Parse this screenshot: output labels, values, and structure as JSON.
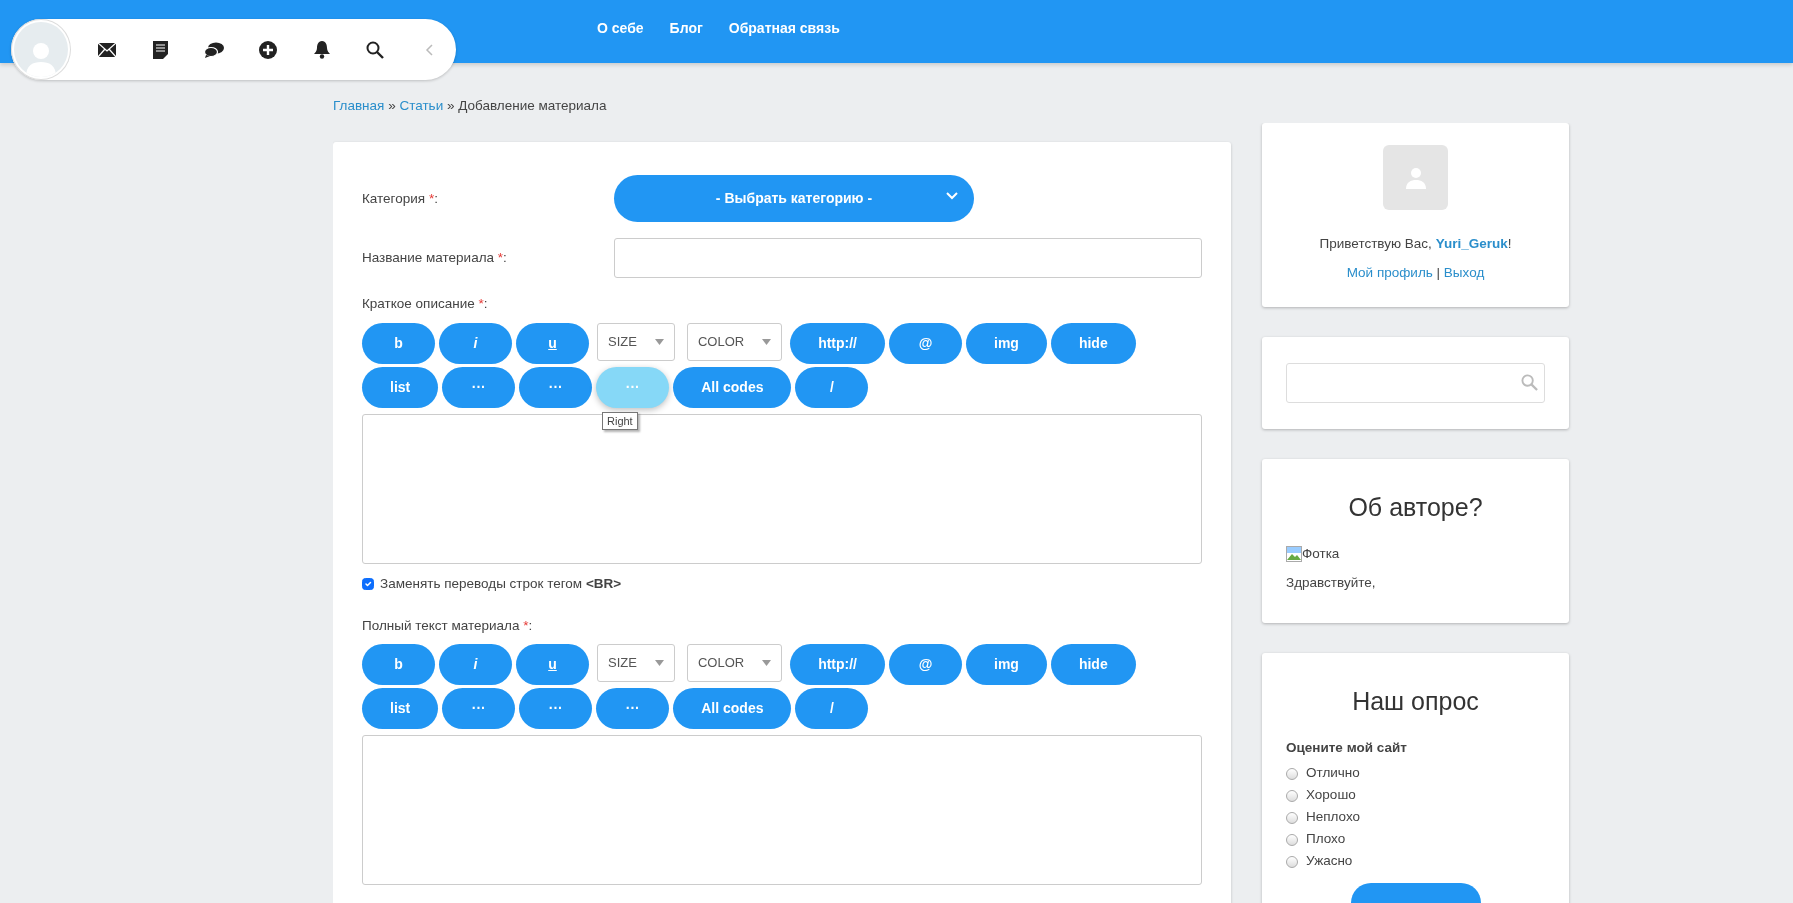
{
  "header": {
    "nav": [
      {
        "label": "О себе"
      },
      {
        "label": "Блог"
      },
      {
        "label": "Обратная связь"
      }
    ]
  },
  "user_bar": {
    "items": [
      {
        "kind": "avatar"
      },
      {
        "kind": "mail"
      },
      {
        "kind": "note"
      },
      {
        "kind": "chat"
      },
      {
        "kind": "add"
      },
      {
        "kind": "bell"
      },
      {
        "kind": "search"
      },
      {
        "kind": "collapse"
      }
    ]
  },
  "breadcrumb": [
    {
      "label": "Главная",
      "kind": "link"
    },
    {
      "label": "»",
      "kind": "sep"
    },
    {
      "label": "Статьи",
      "kind": "link"
    },
    {
      "label": "»",
      "kind": "sep"
    },
    {
      "label": "Добавление материала",
      "kind": "current"
    }
  ],
  "form": {
    "category": {
      "label": "Категория",
      "asterisk": "*",
      "colon": ":",
      "value": "- Выбрать категорию -"
    },
    "title": {
      "label": "Название материала",
      "asterisk": "*",
      "colon": ":"
    },
    "editors": [
      {
        "label": "Краткое описание",
        "asterisk": "*",
        "colon": ":",
        "tooltip": "Right",
        "rows": [
          [
            {
              "label": "b",
              "kind": "bold",
              "hovered": false
            },
            {
              "label": "i",
              "kind": "italic",
              "hovered": false
            },
            {
              "label": "u",
              "kind": "underline",
              "hovered": false
            },
            {
              "label": "SIZE",
              "kind": "select",
              "hovered": false
            },
            {
              "label": "COLOR",
              "kind": "select",
              "hovered": false
            },
            {
              "label": "http://",
              "kind": "plain",
              "hovered": false
            },
            {
              "label": "@",
              "kind": "plain",
              "hovered": false
            },
            {
              "label": "img",
              "kind": "plain",
              "hovered": false
            },
            {
              "label": "hide",
              "kind": "plain",
              "hovered": false
            }
          ],
          [
            {
              "label": "list",
              "kind": "plain",
              "hovered": false
            },
            {
              "label": "···",
              "kind": "plain",
              "hovered": false
            },
            {
              "label": "···",
              "kind": "plain",
              "hovered": false
            },
            {
              "label": "···",
              "kind": "plain",
              "hovered": true
            },
            {
              "label": "All codes",
              "kind": "plain",
              "hovered": false
            },
            {
              "label": "/",
              "kind": "plain",
              "hovered": false
            }
          ]
        ],
        "checkbox": {
          "text": "Заменять переводы строк тегом **<BR>**",
          "checked": true
        }
      },
      {
        "label": "Полный текст материала",
        "asterisk": "*",
        "colon": ":",
        "rows": [
          [
            {
              "label": "b",
              "kind": "bold",
              "hovered": false
            },
            {
              "label": "i",
              "kind": "italic",
              "hovered": false
            },
            {
              "label": "u",
              "kind": "underline",
              "hovered": false
            },
            {
              "label": "SIZE",
              "kind": "select",
              "hovered": false
            },
            {
              "label": "COLOR",
              "kind": "select",
              "hovered": false
            },
            {
              "label": "http://",
              "kind": "plain",
              "hovered": false
            },
            {
              "label": "@",
              "kind": "plain",
              "hovered": false
            },
            {
              "label": "img",
              "kind": "plain",
              "hovered": false
            },
            {
              "label": "hide",
              "kind": "plain",
              "hovered": false
            }
          ],
          [
            {
              "label": "list",
              "kind": "plain",
              "hovered": false
            },
            {
              "label": "···",
              "kind": "plain",
              "hovered": false
            },
            {
              "label": "···",
              "kind": "plain",
              "hovered": false
            },
            {
              "label": "···",
              "kind": "plain",
              "hovered": false
            },
            {
              "label": "All codes",
              "kind": "plain",
              "hovered": false
            },
            {
              "label": "/",
              "kind": "plain",
              "hovered": false
            }
          ]
        ]
      }
    ]
  },
  "sidebar": {
    "login": {
      "greeting": "Приветствую Вас, ",
      "username": "Yuri_Geruk",
      "after": "!",
      "links": [
        {
          "label": "Мой профиль",
          "kind": "link"
        },
        {
          "label": "|",
          "kind": "sep"
        },
        {
          "label": "Выход",
          "kind": "link"
        }
      ]
    },
    "about": {
      "title": "Об авторе?",
      "image_alt": "Фотка",
      "text": "Здравствуйте,"
    },
    "poll": {
      "title": "Наш опрос",
      "question": "Оцените мой сайт",
      "options": [
        {
          "label": "Отлично",
          "selected": false
        },
        {
          "label": "Хорошо",
          "selected": false
        },
        {
          "label": "Неплохо",
          "selected": false
        },
        {
          "label": "Плохо",
          "selected": false
        },
        {
          "label": "Ужасно",
          "selected": false
        }
      ]
    }
  }
}
